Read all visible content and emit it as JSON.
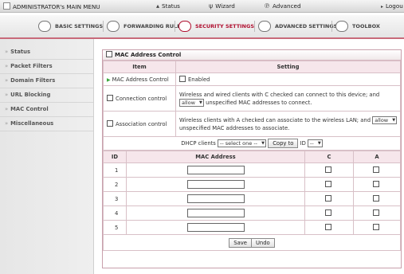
{
  "topbar": {
    "admin_title": "ADMINISTRATOR's MAIN MENU",
    "status": "Status",
    "wizard": "Wizard",
    "advanced": "Advanced",
    "logout": "Logou",
    "status_icon": "status-icon",
    "wizard_icon": "wizard-icon",
    "advanced_icon": "advanced-icon"
  },
  "tabs": [
    {
      "label": "BASIC SETTINGS",
      "icon": "basic-settings-icon"
    },
    {
      "label": "FORWARDING RULES",
      "icon": "forwarding-rules-icon"
    },
    {
      "label": "SECURITY SETTINGS",
      "icon": "security-settings-icon",
      "active": true
    },
    {
      "label": "ADVANCED SETTINGS",
      "icon": "advanced-settings-icon"
    },
    {
      "label": "TOOLBOX",
      "icon": "toolbox-icon"
    }
  ],
  "sidebar": {
    "items": [
      {
        "label": "Status"
      },
      {
        "label": "Packet Filters"
      },
      {
        "label": "Domain Filters"
      },
      {
        "label": "URL Blocking"
      },
      {
        "label": "MAC Control"
      },
      {
        "label": "Miscellaneous"
      }
    ]
  },
  "panel": {
    "title": "MAC Address Control",
    "col_item": "Item",
    "col_setting": "Setting",
    "mac_control_label": "MAC Address Control",
    "enabled_label": "Enabled",
    "connection_label": "Connection control",
    "connection_text_1": "Wireless and wired clients with C checked can connect to this device; and",
    "connection_select": "allow",
    "connection_text_2": "unspecified MAC addresses to connect.",
    "association_label": "Association control",
    "association_text_1": "Wireless clients with A checked can associate to the wireless LAN; and",
    "association_select": "allow",
    "association_text_2": "unspecified MAC addresses to associate.",
    "dhcp_label": "DHCP clients",
    "dhcp_select": "-- select one --",
    "copy_to": "Copy to",
    "id_label": "ID",
    "id_select": "--",
    "table_headers": {
      "id": "ID",
      "mac": "MAC Address",
      "c": "C",
      "a": "A"
    },
    "rows": [
      {
        "id": "1",
        "mac": ""
      },
      {
        "id": "2",
        "mac": ""
      },
      {
        "id": "3",
        "mac": ""
      },
      {
        "id": "4",
        "mac": ""
      },
      {
        "id": "5",
        "mac": ""
      }
    ],
    "save": "Save",
    "undo": "Undo"
  },
  "colors": {
    "accent": "#b01030",
    "border": "#c9a0ac",
    "header_bg": "#f6e6eb"
  }
}
